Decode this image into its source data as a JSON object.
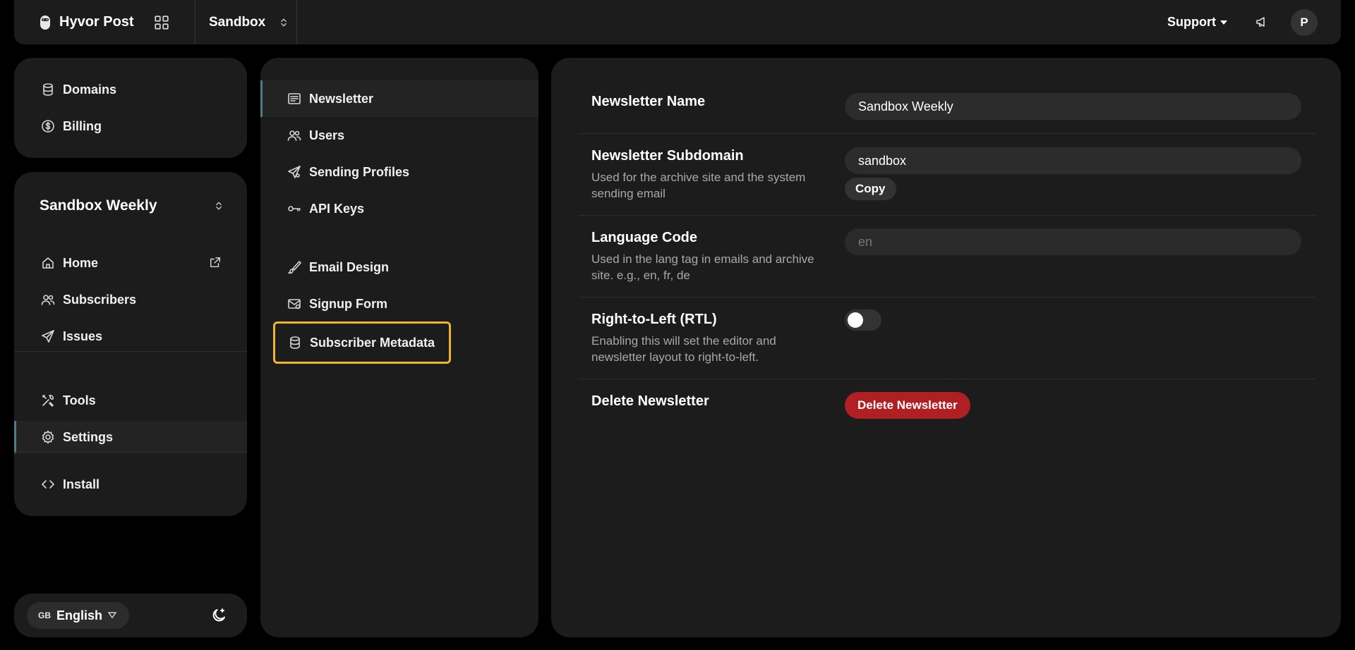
{
  "header": {
    "brand": "Hyvor Post",
    "project": "Sandbox",
    "support": "Support",
    "avatar_initial": "P"
  },
  "account_nav": [
    {
      "label": "Domains",
      "icon": "database-icon"
    },
    {
      "label": "Billing",
      "icon": "dollar-icon"
    }
  ],
  "newsletter_nav": {
    "selected_newsletter": "Sandbox Weekly",
    "items": [
      {
        "label": "Home",
        "icon": "home-icon"
      },
      {
        "label": "Subscribers",
        "icon": "users-icon"
      },
      {
        "label": "Issues",
        "icon": "send-icon"
      },
      {
        "label": "Tools",
        "icon": "tools-icon"
      },
      {
        "label": "Settings",
        "icon": "gear-icon",
        "active": true
      },
      {
        "label": "Install",
        "icon": "code-icon"
      }
    ]
  },
  "footer": {
    "language_flag": "GB",
    "language": "English"
  },
  "settings_nav": [
    {
      "label": "Newsletter",
      "icon": "newsletter-icon",
      "active": true
    },
    {
      "label": "Users",
      "icon": "users-icon"
    },
    {
      "label": "Sending Profiles",
      "icon": "send-icon"
    },
    {
      "label": "API Keys",
      "icon": "key-icon"
    },
    {
      "label": "Email Design",
      "icon": "brush-icon"
    },
    {
      "label": "Signup Form",
      "icon": "envelope-icon"
    },
    {
      "label": "Subscriber Metadata",
      "icon": "database-icon",
      "highlighted": true
    }
  ],
  "settings": {
    "name": {
      "title": "Newsletter Name",
      "value": "Sandbox Weekly"
    },
    "subdomain": {
      "title": "Newsletter Subdomain",
      "description": "Used for the archive site and the system sending email",
      "value": "sandbox",
      "copy_label": "Copy"
    },
    "language": {
      "title": "Language Code",
      "description": "Used in the lang tag in emails and archive site. e.g., en, fr, de",
      "placeholder": "en"
    },
    "rtl": {
      "title": "Right-to-Left (RTL)",
      "description": "Enabling this will set the editor and newsletter layout to right-to-left.",
      "enabled": false
    },
    "delete": {
      "title": "Delete Newsletter",
      "button_label": "Delete Newsletter"
    }
  },
  "colors": {
    "accent_highlight": "#f1b52b",
    "danger": "#b01f24",
    "active_indicator": "#4a7d87"
  }
}
